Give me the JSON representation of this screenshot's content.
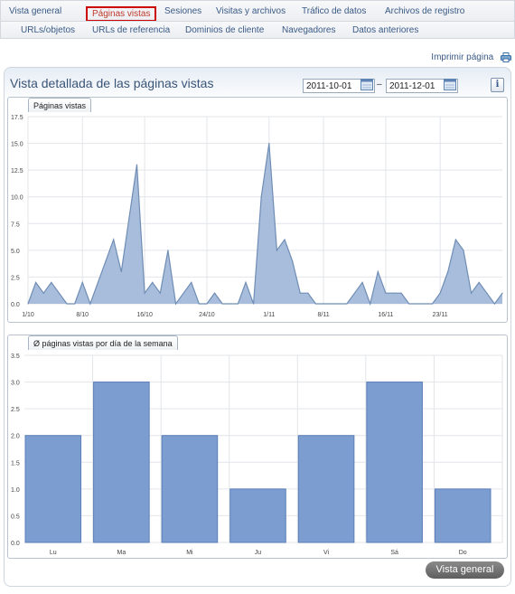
{
  "nav": {
    "row1": [
      "Vista general",
      "Páginas vistas",
      "Sesiones",
      "Visitas y archivos",
      "Tráfico de datos",
      "Archivos de registro"
    ],
    "active": "Páginas vistas",
    "row2": [
      "URLs/objetos",
      "URLs de referencia",
      "Dominios de cliente",
      "Navegadores",
      "Datos anteriores"
    ]
  },
  "print_label": "Imprimir página",
  "page_title": "Vista detallada de las páginas vistas",
  "date_from": "2011-10-01",
  "date_separator": "–",
  "date_to": "2011-12-01",
  "info_label": "i",
  "overview_button": "Vista general",
  "colors": {
    "fill": "#a8bddb",
    "stroke": "#6f8db5",
    "bar": "#7b9dcf",
    "bar_stroke": "#5b7fb8",
    "nav_text": "#3a5a85",
    "active": "#cc0000"
  },
  "chart_data": [
    {
      "type": "area",
      "title": "Páginas vistas",
      "x": [
        "2011-10-01",
        "2011-10-02",
        "2011-10-03",
        "2011-10-04",
        "2011-10-05",
        "2011-10-06",
        "2011-10-07",
        "2011-10-08",
        "2011-10-09",
        "2011-10-10",
        "2011-10-11",
        "2011-10-12",
        "2011-10-13",
        "2011-10-14",
        "2011-10-15",
        "2011-10-16",
        "2011-10-17",
        "2011-10-18",
        "2011-10-19",
        "2011-10-20",
        "2011-10-21",
        "2011-10-22",
        "2011-10-23",
        "2011-10-24",
        "2011-10-25",
        "2011-10-26",
        "2011-10-27",
        "2011-10-28",
        "2011-10-29",
        "2011-10-30",
        "2011-10-31",
        "2011-11-01",
        "2011-11-02",
        "2011-11-03",
        "2011-11-04",
        "2011-11-05",
        "2011-11-06",
        "2011-11-07",
        "2011-11-08",
        "2011-11-09",
        "2011-11-10",
        "2011-11-11",
        "2011-11-12",
        "2011-11-13",
        "2011-11-14",
        "2011-11-15",
        "2011-11-16",
        "2011-11-17",
        "2011-11-18",
        "2011-11-19",
        "2011-11-20",
        "2011-11-21",
        "2011-11-22",
        "2011-11-23",
        "2011-11-24",
        "2011-11-25",
        "2011-11-26",
        "2011-11-27",
        "2011-11-28",
        "2011-11-29",
        "2011-11-30",
        "2011-12-01"
      ],
      "values": [
        0,
        2,
        1,
        2,
        1,
        0,
        0,
        2,
        0,
        2,
        4,
        6,
        3,
        8,
        13,
        1,
        2,
        1,
        5,
        0,
        1,
        2,
        0,
        0,
        1,
        0,
        0,
        0,
        2,
        0,
        10,
        15,
        5,
        6,
        4,
        1,
        1,
        0,
        0,
        0,
        0,
        0,
        1,
        2,
        0,
        3,
        1,
        1,
        1,
        0,
        0,
        0,
        0,
        1,
        3,
        6,
        5,
        1,
        2,
        1,
        0,
        1
      ],
      "xticks": [
        "1/10",
        "8/10",
        "16/10",
        "24/10",
        "1/11",
        "8/11",
        "16/11",
        "23/11"
      ],
      "xtick_dates": [
        "2011-10-01",
        "2011-10-08",
        "2011-10-16",
        "2011-10-24",
        "2011-11-01",
        "2011-11-08",
        "2011-11-16",
        "2011-11-23"
      ],
      "yticks": [
        "0.0",
        "2.5",
        "5.0",
        "7.5",
        "10.0",
        "12.5",
        "15.0",
        "17.5"
      ],
      "ylim": [
        0,
        17.5
      ],
      "grid": true
    },
    {
      "type": "bar",
      "title": "Ø páginas vistas por día de la semana",
      "categories": [
        "Lu",
        "Ma",
        "Mi",
        "Ju",
        "Vi",
        "Sá",
        "Do"
      ],
      "values": [
        2.0,
        3.0,
        2.0,
        1.0,
        2.0,
        3.0,
        1.0
      ],
      "yticks": [
        "0.0",
        "0.5",
        "1.0",
        "1.5",
        "2.0",
        "2.5",
        "3.0",
        "3.5"
      ],
      "ylim": [
        0,
        3.5
      ],
      "grid": true
    }
  ]
}
